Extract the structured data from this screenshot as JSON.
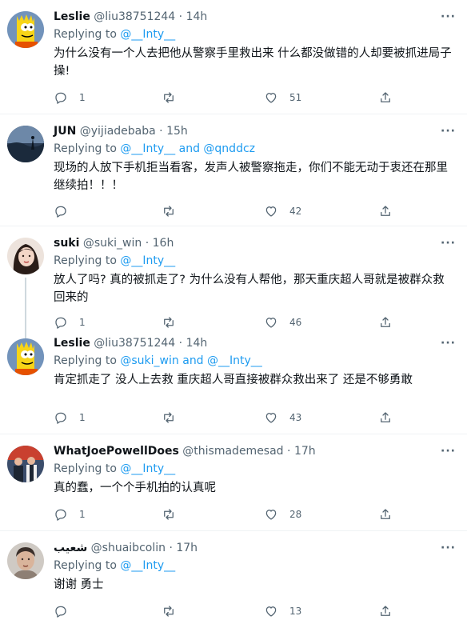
{
  "tweets": [
    {
      "name": "Leslie",
      "handle": "@liu38751244",
      "time": "14h",
      "reply_prefix": "Replying to",
      "reply_to": "@__Inty__",
      "reply_and": "",
      "reply_to2": "",
      "text": "为什么没有一个人去把他从警察手里救出来  什么都没做错的人却要被抓进局子  操!",
      "replies": "1",
      "retweets": "",
      "likes": "51",
      "avatar": "bart-simpson-avatar"
    },
    {
      "name": "JUN",
      "handle": "@yijiadebaba",
      "time": "15h",
      "reply_prefix": "Replying to",
      "reply_to": "@__Inty__",
      "reply_and": "and",
      "reply_to2": "@qnddcz",
      "text": "现场的人放下手机拒当看客，发声人被警察拖走，你们不能无动于衷还在那里继续拍！！！",
      "replies": "",
      "retweets": "",
      "likes": "42",
      "avatar": "landscape-avatar"
    },
    {
      "name": "suki",
      "handle": "@suki_win",
      "time": "16h",
      "reply_prefix": "Replying to",
      "reply_to": "@__Inty__",
      "reply_and": "",
      "reply_to2": "",
      "text": "放人了吗? 真的被抓走了? 为什么没有人帮他，那天重庆超人哥就是被群众救回来的",
      "replies": "1",
      "retweets": "",
      "likes": "46",
      "avatar": "woman-portrait-avatar"
    },
    {
      "name": "Leslie",
      "handle": "@liu38751244",
      "time": "14h",
      "reply_prefix": "Replying to",
      "reply_to": "@suki_win",
      "reply_and": "and",
      "reply_to2": "@__Inty__",
      "text": "肯定抓走了 没人上去救 重庆超人哥直接被群众救出来了 还是不够勇敢",
      "replies": "1",
      "retweets": "",
      "likes": "43",
      "avatar": "bart-simpson-avatar"
    },
    {
      "name": "WhatJoePowellDoes",
      "handle": "@thismademesad",
      "time": "17h",
      "reply_prefix": "Replying to",
      "reply_to": "@__Inty__",
      "reply_and": "",
      "reply_to2": "",
      "text": "真的蠢，一个个手机拍的认真呢",
      "replies": "1",
      "retweets": "",
      "likes": "28",
      "avatar": "group-photo-avatar"
    },
    {
      "name": "شعيب",
      "handle": "@shuaibcolin",
      "time": "17h",
      "reply_prefix": "Replying to",
      "reply_to": "@__Inty__",
      "reply_and": "",
      "reply_to2": "",
      "text": "谢谢 勇士",
      "replies": "",
      "retweets": "",
      "likes": "13",
      "avatar": "man-portrait-avatar"
    }
  ],
  "ui": {
    "dot": "·",
    "more": "···"
  },
  "colors": {
    "link": "#1d9bf0",
    "muted": "#536471",
    "text": "#0f1419",
    "divider": "#eff3f4"
  },
  "icons": {
    "reply": "reply-icon",
    "retweet": "retweet-icon",
    "like": "heart-icon",
    "share": "share-icon"
  }
}
